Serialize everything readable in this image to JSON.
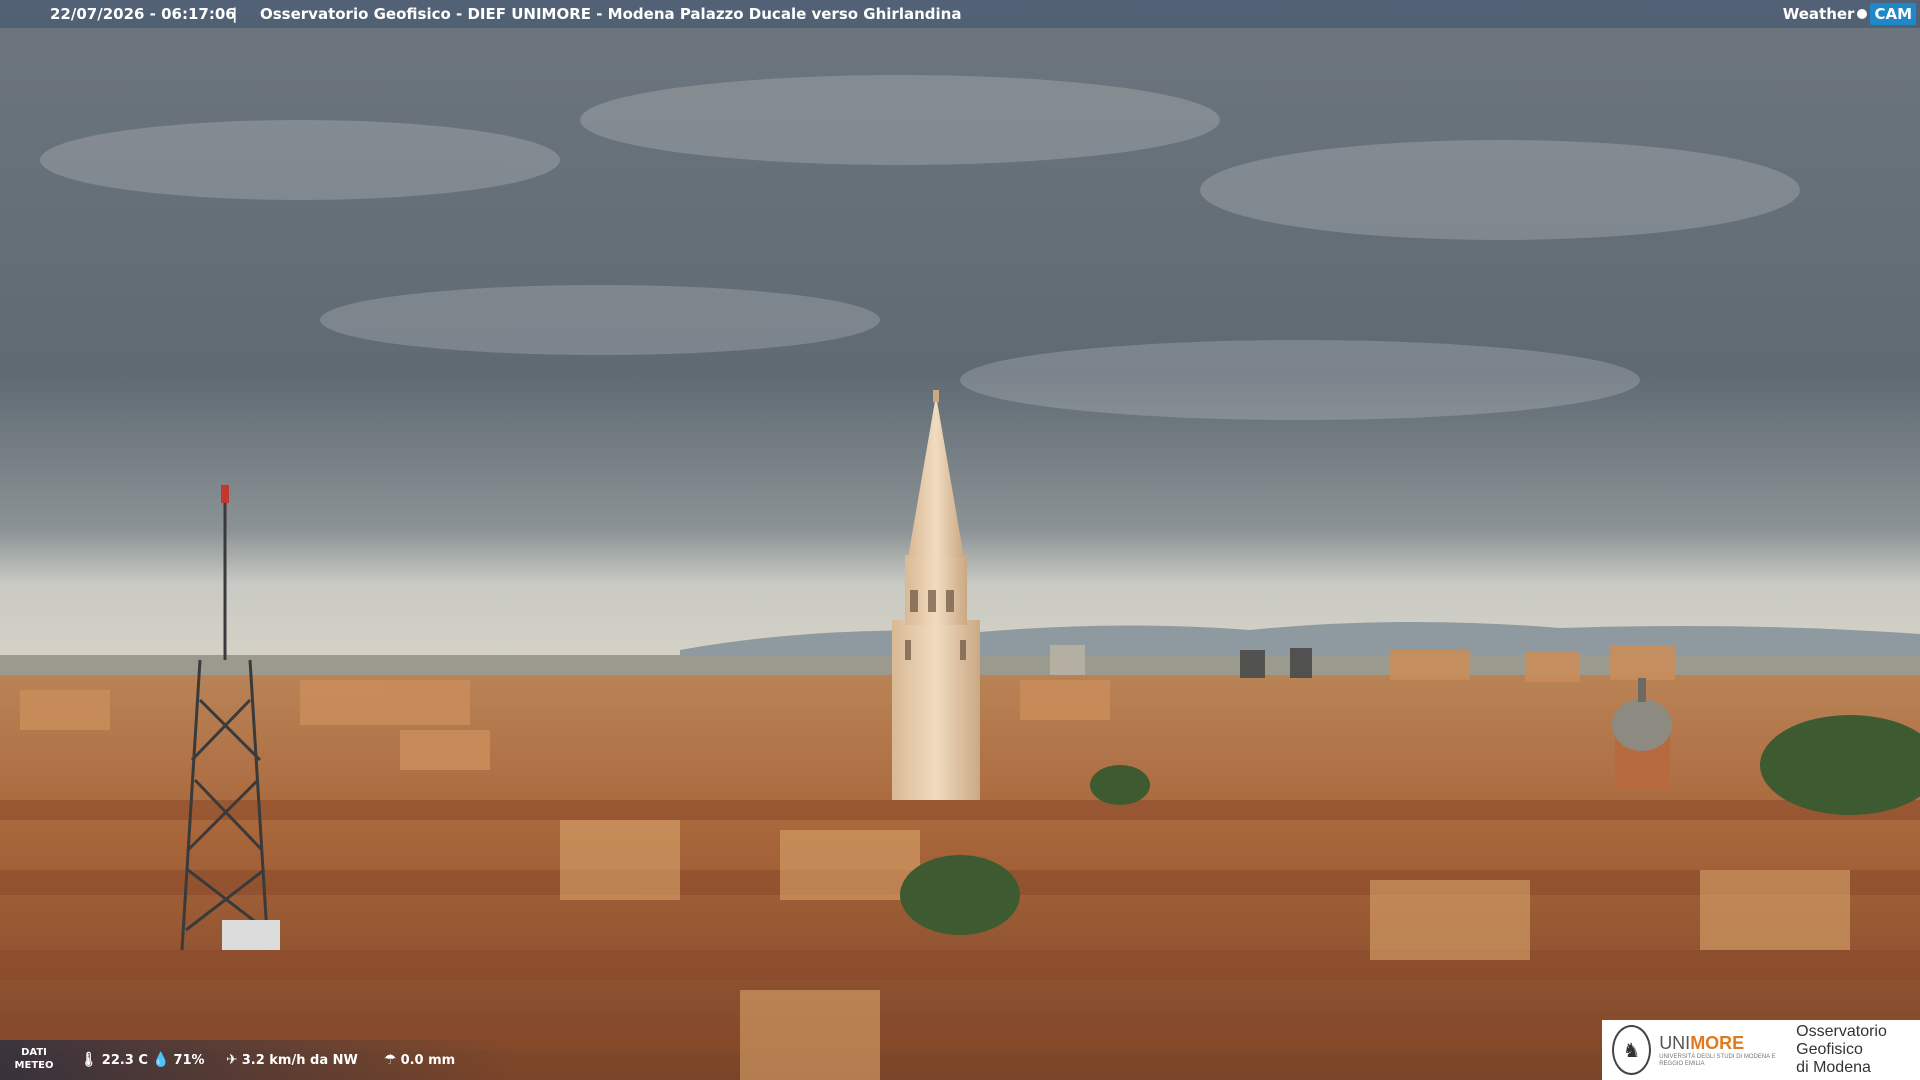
{
  "overlay": {
    "timestamp": "22/07/2026 - 06:17:06",
    "separator": "|",
    "title": "Osservatorio Geofisico - DIEF UNIMORE - Modena Palazzo Ducale verso Ghirlandina",
    "brand_weather": "Weather",
    "brand_cam": "CAM"
  },
  "meteo": {
    "label": "DATI METEO",
    "temperature": "22.3 C",
    "humidity": "71%",
    "wind": "3.2 km/h da NW",
    "rain": "0.0 mm",
    "icons": [
      "thermometer-icon",
      "humidity-icon",
      "wind-icon",
      "rain-icon"
    ]
  },
  "logo": {
    "unimore_a": "UNI",
    "unimore_b": "MORE",
    "unimore_sub": "UNIVERSITÀ DEGLI STUDI DI MODENA E REGGIO EMILIA",
    "observatory_line1": "Osservatorio Geofisico",
    "observatory_line2": "di Modena"
  },
  "colors": {
    "sky_top": "#6e7780",
    "sky_low": "#bfc3c1",
    "roofs": "#a65c32",
    "tower": "#e8cfae",
    "accent_orange": "#e07a1f"
  }
}
